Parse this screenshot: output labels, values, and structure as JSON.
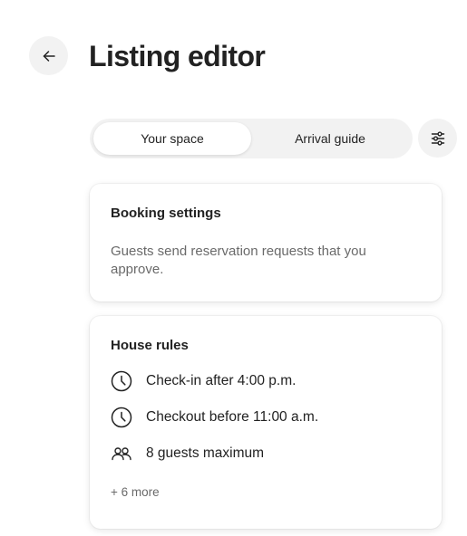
{
  "header": {
    "title": "Listing editor",
    "back_icon": "arrow-left-icon"
  },
  "tabs": [
    {
      "label": "Your space",
      "active": true
    },
    {
      "label": "Arrival guide",
      "active": false
    }
  ],
  "filter_icon": "sliders-icon",
  "booking_card": {
    "title": "Booking settings",
    "description": "Guests send reservation requests that you approve."
  },
  "rules_card": {
    "title": "House rules",
    "items": [
      {
        "icon": "clock-icon",
        "label": "Check-in after 4:00 p.m."
      },
      {
        "icon": "clock-icon",
        "label": "Checkout before 11:00 a.m."
      },
      {
        "icon": "guests-icon",
        "label": "8 guests maximum"
      }
    ],
    "more_label": "+ 6 more"
  },
  "colors": {
    "text_primary": "#222222",
    "text_secondary": "#6a6a6a",
    "surface_gray": "#f2f2f2",
    "card_background": "#ffffff"
  }
}
